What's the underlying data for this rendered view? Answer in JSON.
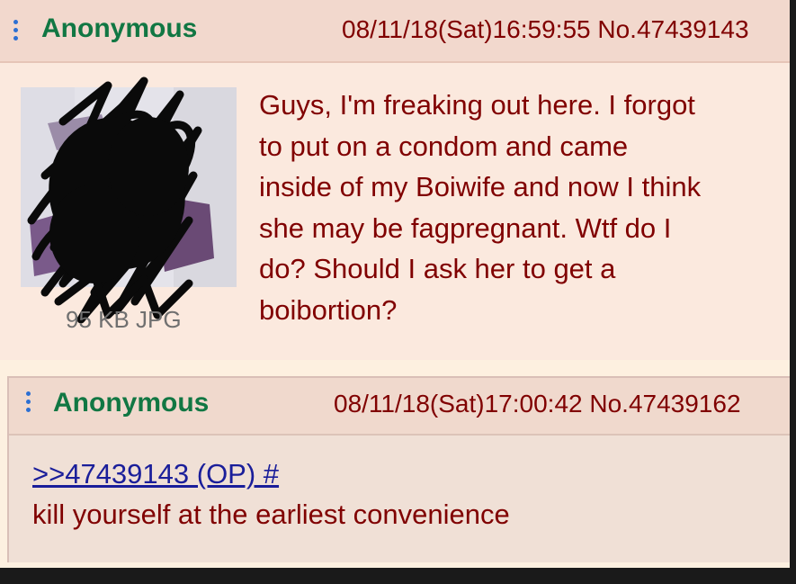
{
  "op": {
    "name": "Anonymous",
    "datetime": "08/11/18(Sat)16:59:55",
    "post_no": "No.47439143",
    "file_info": "95 KB JPG",
    "comment_lines": [
      "Guys, I'm freaking out here. I forgot",
      "to put on a condom and came",
      "inside of my Boiwife and now I think",
      "she may be fagpregnant. Wtf do I",
      "do? Should I ask her to get a",
      "boibortion?"
    ]
  },
  "reply": {
    "name": "Anonymous",
    "datetime": "08/11/18(Sat)17:00:42",
    "post_no": "No.47439162",
    "quote_link": ">>47439143 (OP) #",
    "comment": "kill yourself at the earliest convenience"
  },
  "colors": {
    "name": "#117743",
    "text": "#800000",
    "link": "#1a1e9a",
    "menu_dots": "#2c6fd3"
  },
  "icons": {
    "post_menu": "vertical-ellipsis-icon"
  }
}
